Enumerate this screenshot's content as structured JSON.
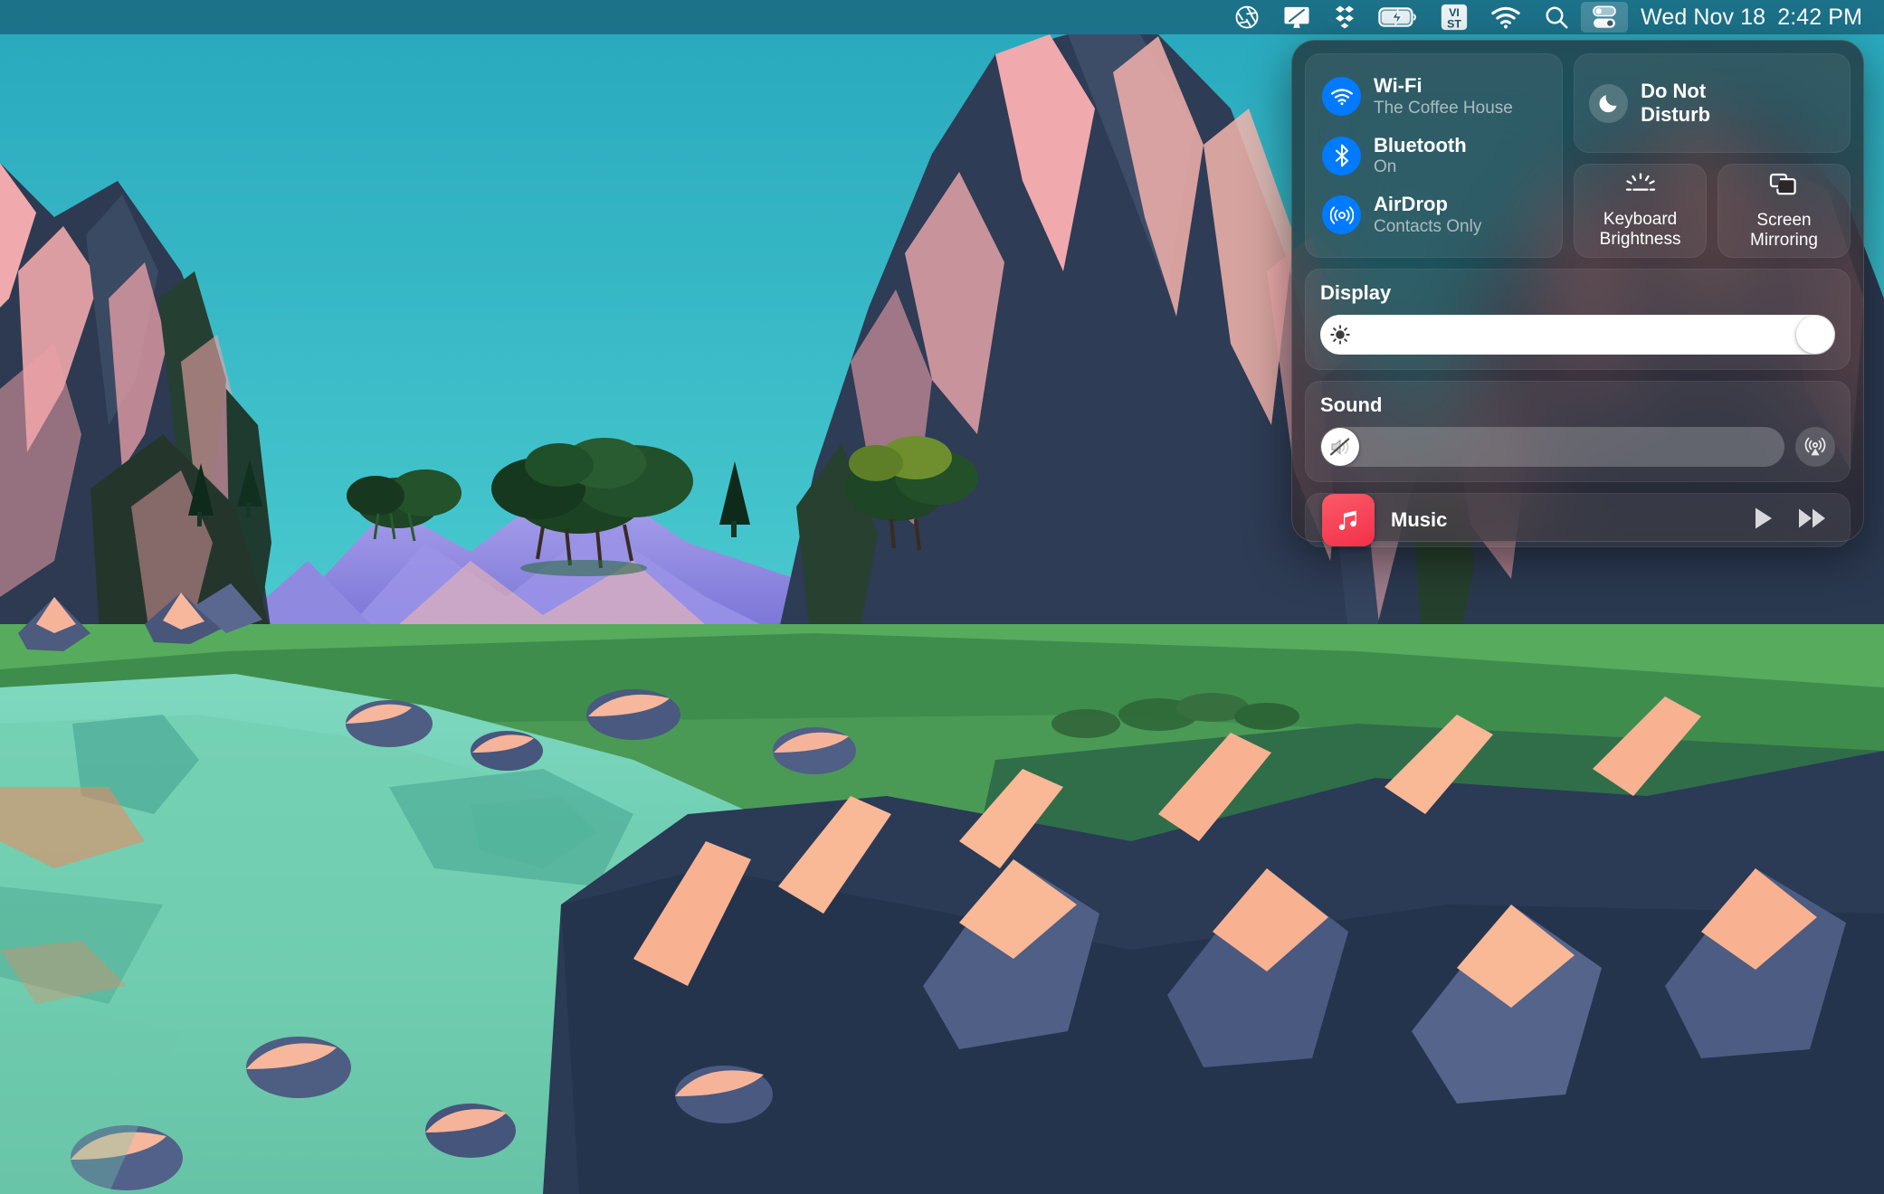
{
  "menubar": {
    "icons": [
      {
        "name": "aperture-icon",
        "label": "Screenshot"
      },
      {
        "name": "display-icon",
        "label": "Display"
      },
      {
        "name": "dropbox-icon",
        "label": "Dropbox"
      },
      {
        "name": "battery-charging-icon",
        "label": "Battery Charging"
      },
      {
        "name": "input-method-icon",
        "label": "VI ST"
      },
      {
        "name": "wifi-icon",
        "label": "Wi-Fi"
      },
      {
        "name": "spotlight-search-icon",
        "label": "Spotlight Search"
      },
      {
        "name": "control-center-icon",
        "label": "Control Center"
      }
    ],
    "input_method_top": "VI",
    "input_method_bottom": "ST",
    "date": "Wed Nov 18",
    "time": "2:42 PM"
  },
  "control_center": {
    "connectivity": [
      {
        "icon": "wifi-icon",
        "title": "Wi-Fi",
        "subtitle": "The Coffee House",
        "state": "on"
      },
      {
        "icon": "bluetooth-icon",
        "title": "Bluetooth",
        "subtitle": "On",
        "state": "on"
      },
      {
        "icon": "airdrop-icon",
        "title": "AirDrop",
        "subtitle": "Contacts Only",
        "state": "on"
      }
    ],
    "do_not_disturb": {
      "icon": "moon-icon",
      "label": "Do Not\nDisturb",
      "line1": "Do Not",
      "line2": "Disturb",
      "state": "off"
    },
    "tiles": [
      {
        "icon": "keyboard-brightness-icon",
        "line1": "Keyboard",
        "line2": "Brightness"
      },
      {
        "icon": "screen-mirroring-icon",
        "line1": "Screen",
        "line2": "Mirroring"
      }
    ],
    "display": {
      "title": "Display",
      "icon": "brightness-sun-icon",
      "value": 100
    },
    "sound": {
      "title": "Sound",
      "icon": "speaker-muted-icon",
      "value": 0,
      "airplay_icon": "airplay-audio-icon"
    },
    "music": {
      "app_name": "Music",
      "app_icon": "music-note-icon",
      "controls": [
        {
          "name": "play-button",
          "icon": "play-icon"
        },
        {
          "name": "next-button",
          "icon": "fast-forward-icon"
        }
      ]
    }
  },
  "colors": {
    "accent_blue": "#007aff",
    "panel_bg": "#2a262a",
    "menubar_bg": "#12465e",
    "music_red": "#f23049",
    "sky_top": "#2fb8c6",
    "sky_bottom": "#5fd4d0"
  }
}
